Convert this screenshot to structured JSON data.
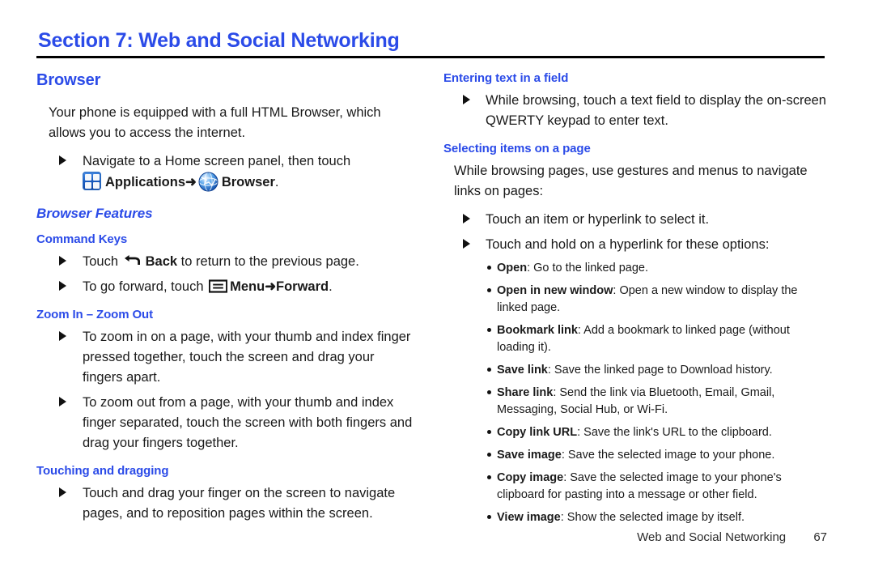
{
  "theme": {
    "accent": "#2b4be8",
    "text": "#1a1a1a",
    "rule": "#000000"
  },
  "header": {
    "section_title": "Section 7: Web and Social Networking"
  },
  "left_column": {
    "browser_heading": "Browser",
    "intro": "Your phone is equipped with a full HTML Browser, which allows you to access the internet.",
    "navigate_item": {
      "lead": "Navigate to a Home screen panel, then touch",
      "apps_label": "Applications",
      "arrow": "➜",
      "browser_label": "Browser",
      "period": ".",
      "apps_icon": "applications-grid-icon",
      "browser_icon": "browser-globe-icon"
    },
    "browser_features_heading": "Browser Features",
    "command_keys_heading": "Command Keys",
    "command_keys": {
      "back_pre": "Touch",
      "back_label": "Back",
      "back_post": "to return to the previous page.",
      "back_icon": "back-arrow-icon",
      "forward_pre": "To go forward, touch",
      "menu_label": "Menu",
      "arrow": "➜",
      "forward_label": "Forward",
      "forward_post": ".",
      "menu_icon": "menu-icon"
    },
    "zoom_heading": "Zoom In – Zoom Out",
    "zoom_items": [
      "To zoom in on a page, with your thumb and index finger pressed together, touch the screen and drag your fingers apart.",
      "To zoom out from a page, with your thumb and index finger separated, touch the screen with both fingers and drag your fingers together."
    ],
    "touching_heading": "Touching and dragging",
    "touching_items": [
      "Touch and drag your finger on the screen to navigate pages, and to reposition pages within the screen."
    ]
  },
  "right_column": {
    "entering_text_heading": "Entering text in a field",
    "entering_text_items": [
      "While browsing, touch a text field to display the on-screen QWERTY keypad to enter text."
    ],
    "selecting_items_heading": "Selecting items on a page",
    "selecting_intro": "While browsing pages, use gestures and menus to navigate links on pages:",
    "selecting_items": [
      "Touch an item or hyperlink to select it.",
      "Touch and hold on a hyperlink for these options:"
    ],
    "options": [
      {
        "term": "Open",
        "desc": ": Go to the linked page."
      },
      {
        "term": "Open in new window",
        "desc": ": Open a new window to display the linked page."
      },
      {
        "term": "Bookmark link",
        "desc": ": Add a bookmark to linked page (without loading it)."
      },
      {
        "term": "Save link",
        "desc": ": Save the linked page to Download history."
      },
      {
        "term": "Share link",
        "desc": ": Send the link via Bluetooth, Email, Gmail, Messaging, Social Hub, or Wi-Fi."
      },
      {
        "term": "Copy link URL",
        "desc": ": Save the link's URL to the clipboard."
      },
      {
        "term": "Save image",
        "desc": ": Save the selected image to your phone."
      },
      {
        "term": "Copy image",
        "desc": ": Save the selected image to your phone's clipboard for pasting into a message or other field."
      },
      {
        "term": "View image",
        "desc": ": Show the selected image by itself."
      }
    ]
  },
  "footer": {
    "chapter_name": "Web and Social Networking",
    "page_number": "67"
  }
}
